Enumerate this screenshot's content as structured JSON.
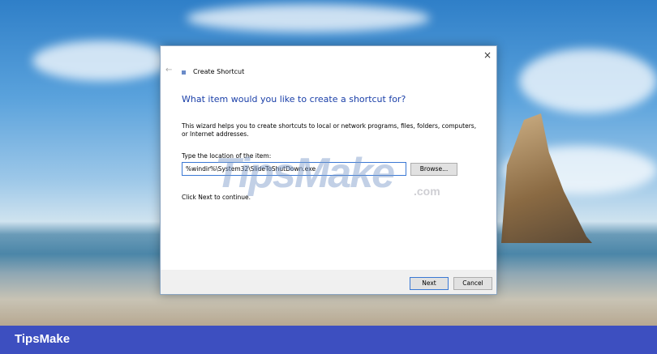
{
  "dialog": {
    "title": "Create Shortcut",
    "close_icon": "×",
    "back_icon": "←",
    "heading": "What item would you like to create a shortcut for?",
    "description": "This wizard helps you to create shortcuts to local or network programs, files, folders, computers, or Internet addresses.",
    "location_label": "Type the location of the item:",
    "location_value": "%windir%\\System32\\SlideToShutDown.exe",
    "browse_label": "Browse...",
    "continue_text": "Click Next to continue.",
    "next_label": "Next",
    "cancel_label": "Cancel"
  },
  "watermark": {
    "main": "TipsMake",
    "suffix": ".com"
  },
  "footer_brand": "TipsMake"
}
